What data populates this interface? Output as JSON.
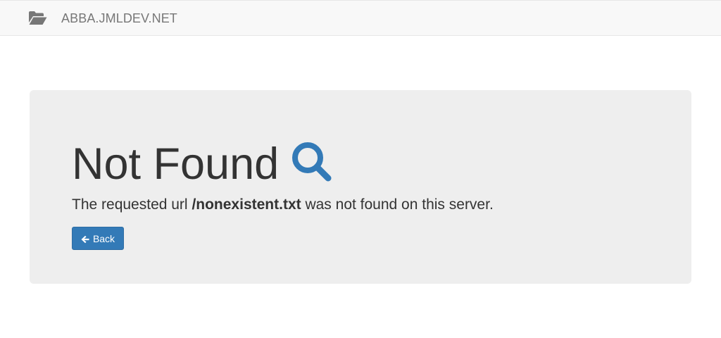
{
  "navbar": {
    "brand_icon": "folder-open-icon",
    "brand_text": "ABBA.JMLDEV.NET"
  },
  "error": {
    "title": "Not Found",
    "title_icon": "search-icon",
    "message_prefix": "The requested url ",
    "requested_url": "/nonexistent.txt",
    "message_suffix": " was not found on this server.",
    "back_icon": "arrow-left-icon",
    "back_label": "Back"
  },
  "colors": {
    "navbar_bg": "#f8f8f8",
    "jumbotron_bg": "#eeeeee",
    "accent": "#337ab7",
    "text": "#333333",
    "brand_text": "#777777"
  }
}
